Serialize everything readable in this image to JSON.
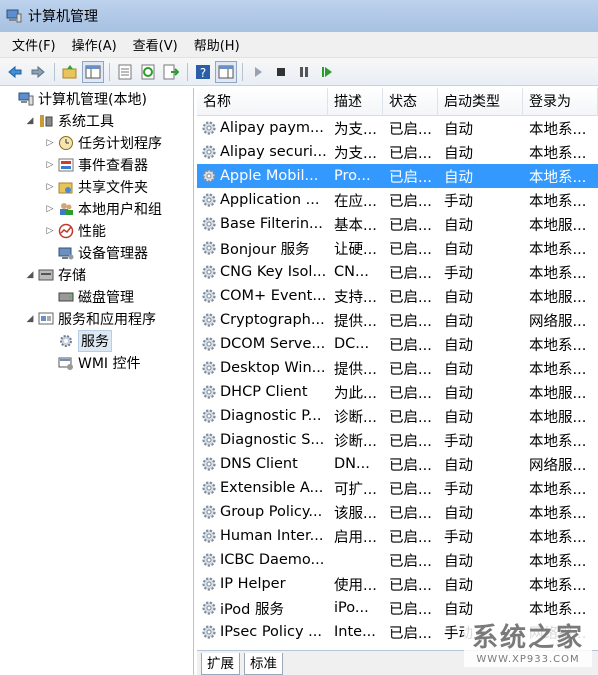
{
  "window": {
    "title": "计算机管理"
  },
  "menu": [
    {
      "label": "文件(F)"
    },
    {
      "label": "操作(A)"
    },
    {
      "label": "查看(V)"
    },
    {
      "label": "帮助(H)"
    }
  ],
  "toolbar": {
    "icons": [
      "back-arrow-icon",
      "forward-arrow-icon",
      "up-folder-icon",
      "show-hide-tree-icon",
      "properties-icon",
      "refresh-icon",
      "export-list-icon",
      "help-icon",
      "action-pane-icon",
      "play-icon",
      "stop-icon",
      "pause-icon",
      "restart-icon"
    ]
  },
  "tree": [
    {
      "label": "计算机管理(本地)",
      "arrow": "",
      "icon": "computer-management-icon",
      "indent": 0
    },
    {
      "label": "系统工具",
      "arrow": "◢",
      "icon": "system-tools-icon",
      "indent": 1
    },
    {
      "label": "任务计划程序",
      "arrow": "▷",
      "icon": "task-scheduler-icon",
      "indent": 2
    },
    {
      "label": "事件查看器",
      "arrow": "▷",
      "icon": "event-viewer-icon",
      "indent": 2
    },
    {
      "label": "共享文件夹",
      "arrow": "▷",
      "icon": "shared-folders-icon",
      "indent": 2
    },
    {
      "label": "本地用户和组",
      "arrow": "▷",
      "icon": "local-users-icon",
      "indent": 2
    },
    {
      "label": "性能",
      "arrow": "▷",
      "icon": "performance-icon",
      "indent": 2
    },
    {
      "label": "设备管理器",
      "arrow": "",
      "icon": "device-manager-icon",
      "indent": 2
    },
    {
      "label": "存储",
      "arrow": "◢",
      "icon": "storage-icon",
      "indent": 1
    },
    {
      "label": "磁盘管理",
      "arrow": "",
      "icon": "disk-management-icon",
      "indent": 2
    },
    {
      "label": "服务和应用程序",
      "arrow": "◢",
      "icon": "services-apps-icon",
      "indent": 1
    },
    {
      "label": "服务",
      "arrow": "",
      "icon": "services-icon",
      "indent": 2,
      "selected": true
    },
    {
      "label": "WMI 控件",
      "arrow": "",
      "icon": "wmi-control-icon",
      "indent": 2
    }
  ],
  "columns": {
    "name": "名称",
    "desc": "描述",
    "status": "状态",
    "start": "启动类型",
    "logon": "登录为"
  },
  "services": [
    {
      "name": "Alipay paym...",
      "desc": "为支...",
      "status": "已启...",
      "start": "自动",
      "logon": "本地系..."
    },
    {
      "name": "Alipay securi...",
      "desc": "为支...",
      "status": "已启...",
      "start": "自动",
      "logon": "本地系..."
    },
    {
      "name": "Apple Mobil...",
      "desc": "Pro...",
      "status": "已启...",
      "start": "自动",
      "logon": "本地系...",
      "selected": true
    },
    {
      "name": "Application ...",
      "desc": "在应...",
      "status": "已启...",
      "start": "手动",
      "logon": "本地系..."
    },
    {
      "name": "Base Filterin...",
      "desc": "基本...",
      "status": "已启...",
      "start": "自动",
      "logon": "本地服..."
    },
    {
      "name": "Bonjour 服务",
      "desc": "让硬...",
      "status": "已启...",
      "start": "自动",
      "logon": "本地系..."
    },
    {
      "name": "CNG Key Isol...",
      "desc": "CN...",
      "status": "已启...",
      "start": "手动",
      "logon": "本地系..."
    },
    {
      "name": "COM+ Event...",
      "desc": "支持...",
      "status": "已启...",
      "start": "自动",
      "logon": "本地服..."
    },
    {
      "name": "Cryptograph...",
      "desc": "提供...",
      "status": "已启...",
      "start": "自动",
      "logon": "网络服..."
    },
    {
      "name": "DCOM Serve...",
      "desc": "DC...",
      "status": "已启...",
      "start": "自动",
      "logon": "本地系..."
    },
    {
      "name": "Desktop Win...",
      "desc": "提供...",
      "status": "已启...",
      "start": "自动",
      "logon": "本地系..."
    },
    {
      "name": "DHCP Client",
      "desc": "为此...",
      "status": "已启...",
      "start": "自动",
      "logon": "本地服..."
    },
    {
      "name": "Diagnostic P...",
      "desc": "诊断...",
      "status": "已启...",
      "start": "自动",
      "logon": "本地服..."
    },
    {
      "name": "Diagnostic S...",
      "desc": "诊断...",
      "status": "已启...",
      "start": "手动",
      "logon": "本地系..."
    },
    {
      "name": "DNS Client",
      "desc": "DN...",
      "status": "已启...",
      "start": "自动",
      "logon": "网络服..."
    },
    {
      "name": "Extensible A...",
      "desc": "可扩...",
      "status": "已启...",
      "start": "手动",
      "logon": "本地系..."
    },
    {
      "name": "Group Policy...",
      "desc": "该服...",
      "status": "已启...",
      "start": "自动",
      "logon": "本地系..."
    },
    {
      "name": "Human Inter...",
      "desc": "启用...",
      "status": "已启...",
      "start": "手动",
      "logon": "本地系..."
    },
    {
      "name": "ICBC Daemo...",
      "desc": "",
      "status": "已启...",
      "start": "自动",
      "logon": "本地系..."
    },
    {
      "name": "IP Helper",
      "desc": "使用...",
      "status": "已启...",
      "start": "自动",
      "logon": "本地系..."
    },
    {
      "name": "iPod 服务",
      "desc": "iPo...",
      "status": "已启...",
      "start": "自动",
      "logon": "本地系..."
    },
    {
      "name": "IPsec Policy ...",
      "desc": "Inte...",
      "status": "已启...",
      "start": "手动",
      "logon": "网络服..."
    }
  ],
  "tabs": [
    {
      "label": "扩展"
    },
    {
      "label": "标准"
    }
  ],
  "watermark": {
    "main": "系统之家",
    "url": "WWW.XP933.COM"
  }
}
